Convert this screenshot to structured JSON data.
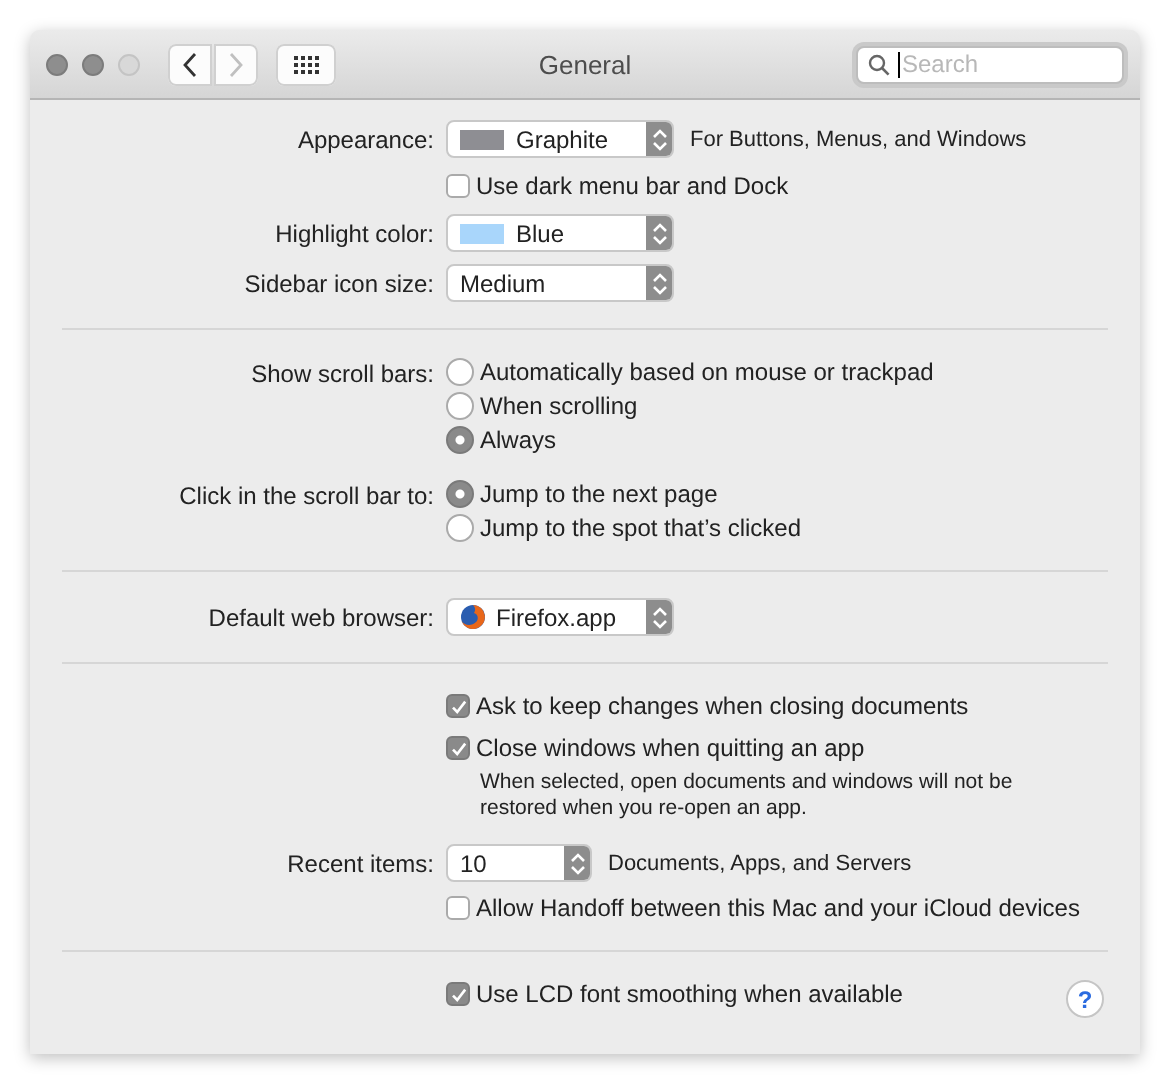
{
  "window": {
    "title": "General",
    "back_disabled": false,
    "forward_disabled": true
  },
  "search": {
    "placeholder": "Search"
  },
  "sections": [
    {
      "rows": [
        {
          "kind": "popup",
          "label": "Appearance:",
          "value": "Graphite",
          "color": "#8e8e93",
          "note": "For Buttons, Menus, and Windows"
        },
        {
          "kind": "checkbox",
          "text": "Use dark menu bar and Dock",
          "checked": false
        },
        {
          "kind": "popup",
          "label": "Highlight color:",
          "value": "Blue",
          "color": "#a9d6fb"
        },
        {
          "kind": "popup",
          "label": "Sidebar icon size:",
          "value": "Medium"
        }
      ]
    },
    {
      "rows": [
        {
          "kind": "radios",
          "label": "Show scroll bars:",
          "options": [
            {
              "text": "Automatically based on mouse or trackpad",
              "selected": false
            },
            {
              "text": "When scrolling",
              "selected": false
            },
            {
              "text": "Always",
              "selected": true
            }
          ]
        },
        {
          "kind": "radios",
          "label": "Click in the scroll bar to:",
          "options": [
            {
              "text": "Jump to the next page",
              "selected": true
            },
            {
              "text": "Jump to the spot that’s clicked",
              "selected": false
            }
          ]
        }
      ]
    },
    {
      "rows": [
        {
          "kind": "app-popup",
          "label": "Default web browser:",
          "value": "Firefox.app"
        }
      ]
    },
    {
      "rows": [
        {
          "kind": "checkbox",
          "text": "Ask to keep changes when closing documents",
          "checked": true
        },
        {
          "kind": "checkbox",
          "text": "Close windows when quitting an app",
          "checked": true,
          "note": "When selected, open documents and windows will not be restored when you re-open an app."
        },
        {
          "kind": "combo",
          "label": "Recent items:",
          "value": "10",
          "note": "Documents, Apps, and Servers"
        },
        {
          "kind": "checkbox",
          "text": "Allow Handoff between this Mac and your iCloud devices",
          "checked": false
        }
      ]
    },
    {
      "rows": [
        {
          "kind": "checkbox",
          "text": "Use LCD font smoothing when available",
          "checked": true
        }
      ],
      "help": "?"
    }
  ]
}
